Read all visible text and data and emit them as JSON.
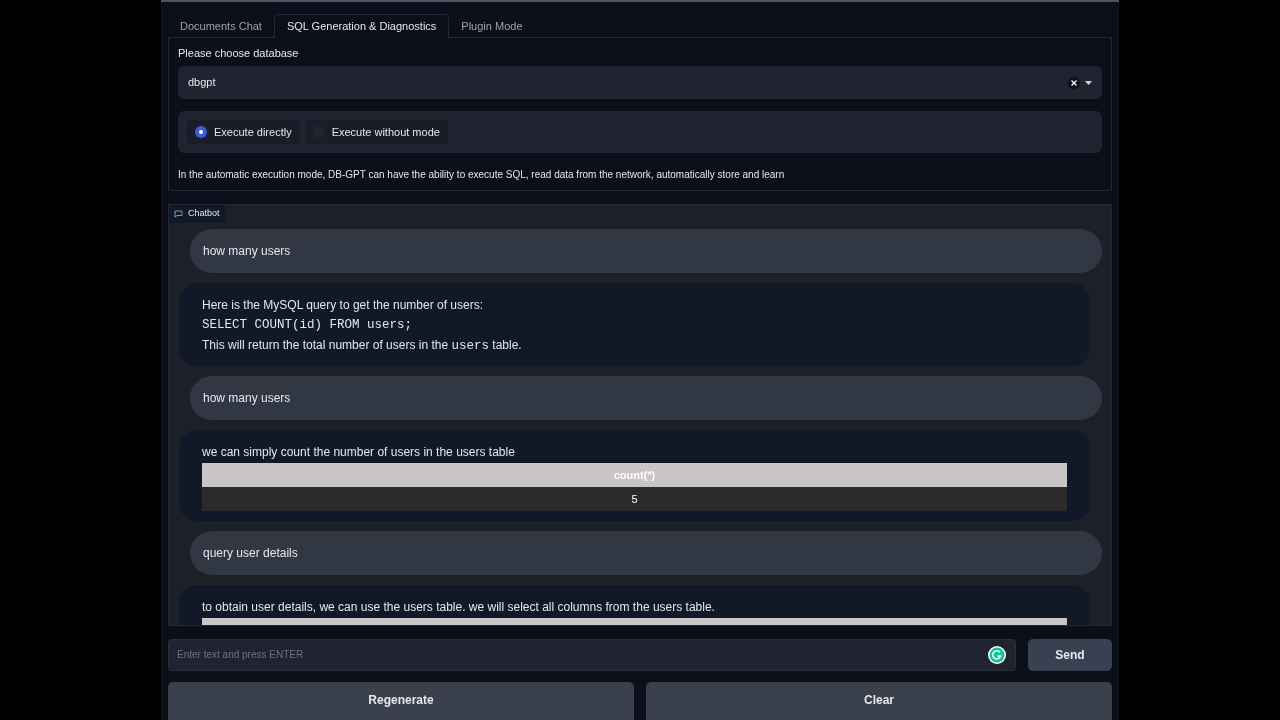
{
  "tabs": [
    {
      "label": "Documents Chat",
      "selected": false
    },
    {
      "label": "SQL Generation & Diagnostics",
      "selected": true
    },
    {
      "label": "Plugin Mode",
      "selected": false
    }
  ],
  "database": {
    "label": "Please choose database",
    "value": "dbgpt"
  },
  "modes": [
    {
      "label": "Execute directly",
      "selected": true
    },
    {
      "label": "Execute without mode",
      "selected": false
    }
  ],
  "description": "In the automatic execution mode, DB-GPT can have the ability to execute SQL, read data from the network, automatically store and learn",
  "chatbot": {
    "label": "Chatbot",
    "messages": [
      {
        "kind": "user",
        "parts": [
          {
            "kind": "text",
            "text": "how many users"
          }
        ]
      },
      {
        "kind": "bot",
        "parts": [
          {
            "kind": "text",
            "text": "Here is the MySQL query to get the number of users:"
          },
          {
            "kind": "code",
            "text": "SELECT COUNT(id) FROM users;"
          },
          {
            "kind": "mixed",
            "spans": [
              {
                "text": "This will return the total number of users in the ",
                "code": false
              },
              {
                "text": "users",
                "code": true
              },
              {
                "text": " table.",
                "code": false
              }
            ]
          }
        ]
      },
      {
        "kind": "user",
        "parts": [
          {
            "kind": "text",
            "text": "how many users"
          }
        ]
      },
      {
        "kind": "bot",
        "parts": [
          {
            "kind": "text",
            "text": "we can simply count the number of users in the users table"
          },
          {
            "kind": "table",
            "columns": [
              "count(*)"
            ],
            "rows": [
              [
                "5"
              ]
            ]
          }
        ]
      },
      {
        "kind": "user",
        "parts": [
          {
            "kind": "text",
            "text": "query user details"
          }
        ]
      },
      {
        "kind": "bot",
        "parts": [
          {
            "kind": "text",
            "text": "to obtain user details, we can use the users table. we will select all columns from the users table."
          },
          {
            "kind": "table"
          }
        ]
      }
    ]
  },
  "input": {
    "placeholder": "Enter text and press ENTER"
  },
  "send": "Send",
  "actions": [
    "Regenerate",
    "Clear"
  ]
}
